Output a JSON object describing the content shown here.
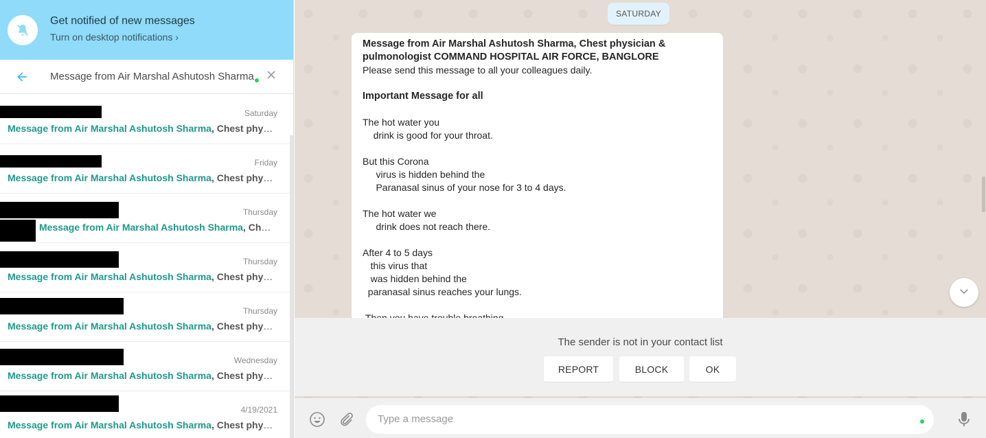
{
  "notification": {
    "title": "Get notified of new messages",
    "link": "Turn on desktop notifications ›"
  },
  "search": {
    "query": "Message from Air Marshal Ashutosh Sharma"
  },
  "results": [
    {
      "date": "Saturday",
      "match": "Message from Air Marshal Ashutosh Sharma",
      "rest": ", Chest physician"
    },
    {
      "date": "Friday",
      "match": "Message from Air Marshal Ashutosh Sharma",
      "rest": ", Chest physician"
    },
    {
      "date": "Thursday",
      "match": "Message from Air Marshal Ashutosh Sharma",
      "rest": ", Chest physician"
    },
    {
      "date": "Thursday",
      "match": "Message from Air Marshal Ashutosh Sharma",
      "rest": ", Chest physician"
    },
    {
      "date": "Thursday",
      "match": "Message from Air Marshal Ashutosh Sharma",
      "rest": ", Chest physician"
    },
    {
      "date": "Wednesday",
      "match": "Message from Air Marshal Ashutosh Sharma",
      "rest": ", Chest physician"
    },
    {
      "date": "4/19/2021",
      "match": "Message from Air Marshal Ashutosh Sharma",
      "rest": ", Chest physician"
    }
  ],
  "chat": {
    "day_chip": "SATURDAY",
    "message": {
      "heading": "Message from Air Marshal Ashutosh Sharma, Chest physician & pulmonologist COMMAND HOSPITAL AIR FORCE, BANGLORE",
      "line1": "Please send this message to all your colleagues daily.",
      "important": "Important Message for all",
      "body": "The hot water you\n    drink is good for your throat.\n\nBut this Corona\n     virus is hidden behind the\n     Paranasal sinus of your nose for 3 to 4 days.\n\nThe hot water we\n     drink does not reach there.\n\nAfter 4 to 5 days\n   this virus that\n   was hidden behind the\n  paranasal sinus reaches your lungs.\n\n Then you have trouble breathing"
    }
  },
  "unknown_sender": {
    "text": "The sender is not in your contact list",
    "report": "REPORT",
    "block": "BLOCK",
    "ok": "OK"
  },
  "composer": {
    "placeholder": "Type a message"
  }
}
